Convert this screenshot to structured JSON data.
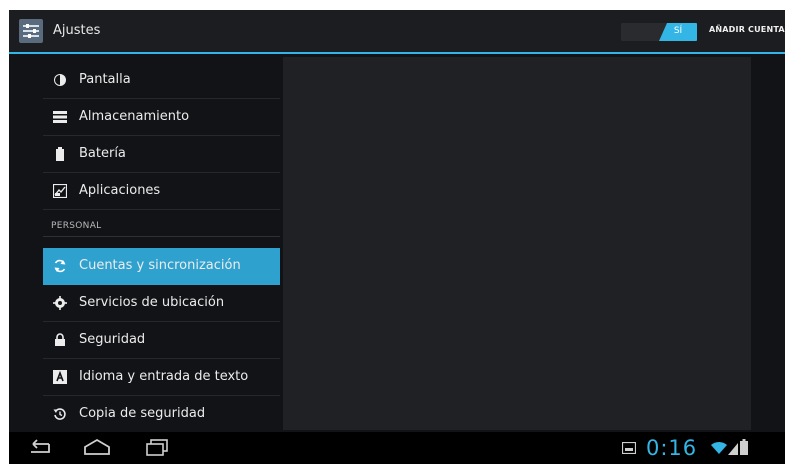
{
  "action_bar": {
    "title": "Ajustes",
    "toggle_label": "SÍ",
    "add_account_label": "AÑADIR CUENTA"
  },
  "sidebar": {
    "section_header": "PERSONAL",
    "items": [
      {
        "label": "Pantalla",
        "icon": "brightness-icon",
        "selected": false
      },
      {
        "label": "Almacenamiento",
        "icon": "storage-icon",
        "selected": false
      },
      {
        "label": "Batería",
        "icon": "battery-icon",
        "selected": false
      },
      {
        "label": "Aplicaciones",
        "icon": "apps-icon",
        "selected": false
      },
      {
        "label": "Cuentas y sincronización",
        "icon": "sync-icon",
        "selected": true
      },
      {
        "label": "Servicios de ubicación",
        "icon": "location-icon",
        "selected": false
      },
      {
        "label": "Seguridad",
        "icon": "lock-icon",
        "selected": false
      },
      {
        "label": "Idioma y entrada de texto",
        "icon": "language-icon",
        "selected": false
      },
      {
        "label": "Copia de seguridad",
        "icon": "backup-icon",
        "selected": false
      }
    ]
  },
  "status_bar": {
    "time": "0:16"
  },
  "colors": {
    "accent": "#33b5e5",
    "selected_row": "#2fa1cf",
    "background": "#121317"
  }
}
